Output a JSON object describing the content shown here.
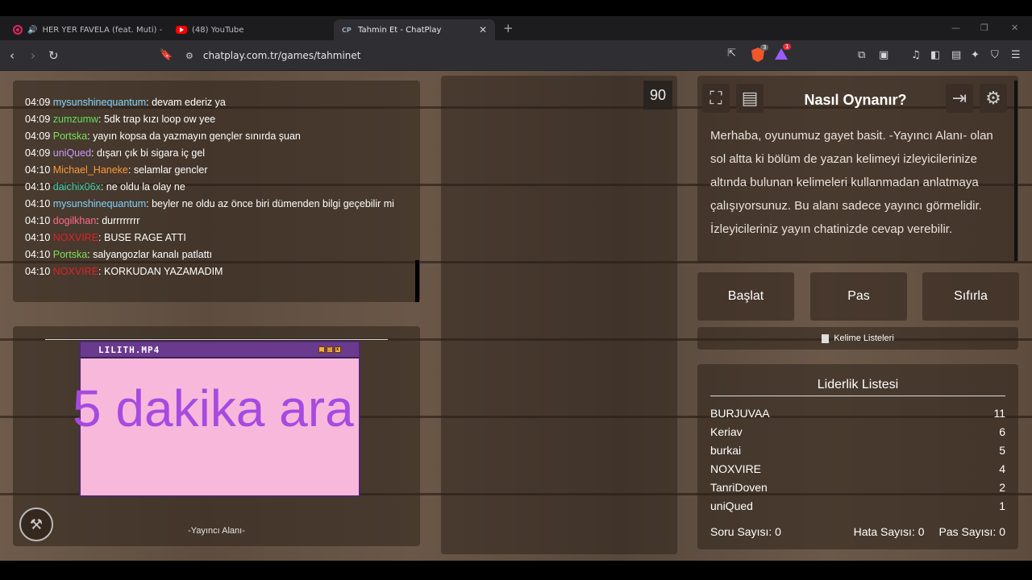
{
  "browser": {
    "tabs": [
      {
        "title": "HER YER FAVELA (feat. Muti) - Yo",
        "icon": "music-icon",
        "active": false
      },
      {
        "title": "(48) YouTube",
        "icon": "youtube-icon",
        "active": false
      },
      {
        "title": "Tahmin Et - ChatPlay",
        "icon": "chatplay-icon",
        "active": true
      }
    ],
    "url": "chatplay.com.tr/games/tahminet",
    "brave_badge": "3",
    "alert_badge": "1"
  },
  "chat": {
    "messages": [
      {
        "time": "04:09",
        "user": "mysunshinequantum",
        "color": "#7fd4ff",
        "text": ": devam ederiz ya"
      },
      {
        "time": "04:09",
        "user": "zumzumw",
        "color": "#5fe05f",
        "text": ": 5dk trap kızı loop ow yee"
      },
      {
        "time": "04:09",
        "user": "Portska",
        "color": "#7ce05a",
        "text": ": yayın kopsa da yazmayın gençler sınırda şuan"
      },
      {
        "time": "04:09",
        "user": "uniQued",
        "color": "#c79bff",
        "text": ": dışarı çık bi sigara iç gel"
      },
      {
        "time": "04:10",
        "user": "Michael_Haneke",
        "color": "#ff9a3c",
        "text": ": selamlar gencler"
      },
      {
        "time": "04:10",
        "user": "daichix06x",
        "color": "#3fd0b0",
        "text": ": ne oldu la olay ne"
      },
      {
        "time": "04:10",
        "user": "mysunshinequantum",
        "color": "#7fd4ff",
        "text": ": beyler ne oldu az önce biri dümenden bilgi geçebilir mi"
      },
      {
        "time": "04:10",
        "user": "dogilkhan",
        "color": "#ff6b8a",
        "text": ": durrrrrrrr"
      },
      {
        "time": "04:10",
        "user": "NOXVIRE",
        "color": "#e0202a",
        "text": ": BUSE RAGE ATTI"
      },
      {
        "time": "04:10",
        "user": "Portska",
        "color": "#7ce05a",
        "text": ": salyangozlar kanalı patlattı"
      },
      {
        "time": "04:10",
        "user": "NOXVIRE",
        "color": "#e0202a",
        "text": ": KORKUDAN YAZAMADIM"
      }
    ]
  },
  "video": {
    "window_title": "LILITH.MP4",
    "overlay_text": "5 dakika ara"
  },
  "yayinci_label": "-Yayıncı Alanı-",
  "timer": "90",
  "info": {
    "title": "Nasıl Oynanır?",
    "text": "Merhaba, oyunumuz gayet basit. -Yayıncı Alanı- olan sol altta ki bölüm de yazan kelimeyi izleyicilerinize altında bulunan kelimeleri kullanmadan anlatmaya çalışıyorsunuz. Bu alanı sadece yayıncı görmelidir. İzleyicileriniz yayın chatinizde cevap verebilir."
  },
  "buttons": {
    "start": "Başlat",
    "pass": "Pas",
    "reset": "Sıfırla"
  },
  "kelime_listeleri": "Kelime Listeleri",
  "leaderboard": {
    "title": "Liderlik Listesi",
    "rows": [
      {
        "name": "BURJUVAA",
        "score": "11"
      },
      {
        "name": "Keriav",
        "score": "6"
      },
      {
        "name": "burkai",
        "score": "5"
      },
      {
        "name": "NOXVIRE",
        "score": "4"
      },
      {
        "name": "TanriDoven",
        "score": "2"
      },
      {
        "name": "uniQued",
        "score": "1"
      }
    ]
  },
  "stats": {
    "soru": "Soru Sayısı: 0",
    "hata": "Hata Sayısı: 0",
    "pas": "Pas Sayısı: 0"
  }
}
